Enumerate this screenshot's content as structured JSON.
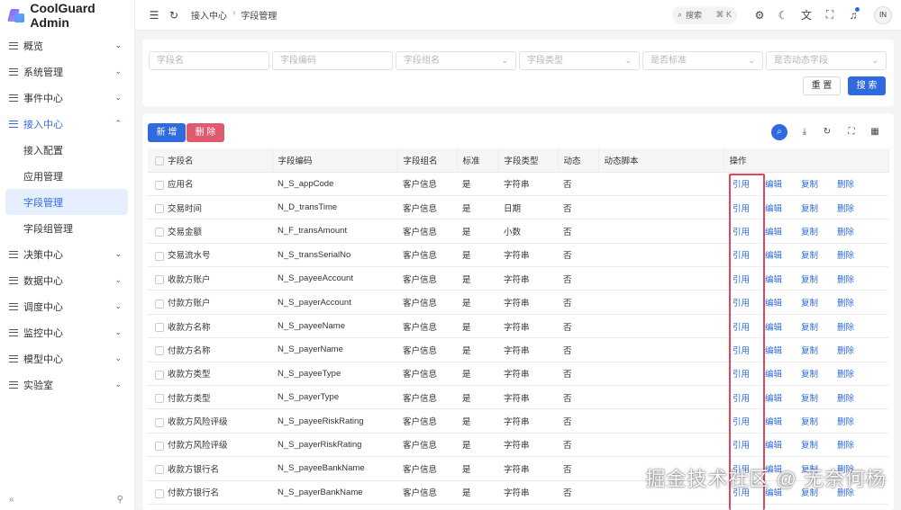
{
  "app": {
    "title": "CoolGuard Admin"
  },
  "sidebar": {
    "items": [
      {
        "label": "概览",
        "open": false
      },
      {
        "label": "系统管理",
        "open": false
      },
      {
        "label": "事件中心",
        "open": false
      },
      {
        "label": "接入中心",
        "open": true,
        "children": [
          {
            "label": "接入配置",
            "active": false
          },
          {
            "label": "应用管理",
            "active": false
          },
          {
            "label": "字段管理",
            "active": true
          },
          {
            "label": "字段组管理",
            "active": false
          }
        ]
      },
      {
        "label": "决策中心",
        "open": false
      },
      {
        "label": "数据中心",
        "open": false
      },
      {
        "label": "调度中心",
        "open": false
      },
      {
        "label": "监控中心",
        "open": false
      },
      {
        "label": "模型中心",
        "open": false
      },
      {
        "label": "实验室",
        "open": false
      }
    ],
    "collapse_icon": "«",
    "pin_icon": "pin-icon"
  },
  "header": {
    "breadcrumb": [
      "接入中心",
      "字段管理"
    ],
    "search_placeholder": "搜索",
    "search_shortcut": "⌘ K",
    "avatar_text": "IN"
  },
  "filters": {
    "field_name_placeholder": "字段名",
    "field_code_placeholder": "字段编码",
    "field_group_placeholder": "字段组名",
    "field_type_placeholder": "字段类型",
    "is_standard_placeholder": "是否标准",
    "is_dynamic_placeholder": "是否动态字段",
    "reset_label": "重 置",
    "search_label": "搜 索"
  },
  "toolbar": {
    "add_label": "新 增",
    "delete_label": "删 除"
  },
  "table": {
    "columns": [
      "字段名",
      "字段编码",
      "字段组名",
      "标准",
      "字段类型",
      "动态",
      "动态脚本",
      "操作"
    ],
    "actions": [
      "引用",
      "编辑",
      "复制",
      "删除"
    ],
    "rows": [
      {
        "name": "应用名",
        "code": "N_S_appCode",
        "group": "客户信息",
        "standard": "是",
        "type": "字符串",
        "dynamic": "否",
        "script": ""
      },
      {
        "name": "交易时间",
        "code": "N_D_transTime",
        "group": "客户信息",
        "standard": "是",
        "type": "日期",
        "dynamic": "否",
        "script": ""
      },
      {
        "name": "交易金额",
        "code": "N_F_transAmount",
        "group": "客户信息",
        "standard": "是",
        "type": "小数",
        "dynamic": "否",
        "script": ""
      },
      {
        "name": "交易流水号",
        "code": "N_S_transSerialNo",
        "group": "客户信息",
        "standard": "是",
        "type": "字符串",
        "dynamic": "否",
        "script": ""
      },
      {
        "name": "收款方账户",
        "code": "N_S_payeeAccount",
        "group": "客户信息",
        "standard": "是",
        "type": "字符串",
        "dynamic": "否",
        "script": ""
      },
      {
        "name": "付款方账户",
        "code": "N_S_payerAccount",
        "group": "客户信息",
        "standard": "是",
        "type": "字符串",
        "dynamic": "否",
        "script": ""
      },
      {
        "name": "收款方名称",
        "code": "N_S_payeeName",
        "group": "客户信息",
        "standard": "是",
        "type": "字符串",
        "dynamic": "否",
        "script": ""
      },
      {
        "name": "付款方名称",
        "code": "N_S_payerName",
        "group": "客户信息",
        "standard": "是",
        "type": "字符串",
        "dynamic": "否",
        "script": ""
      },
      {
        "name": "收款方类型",
        "code": "N_S_payeeType",
        "group": "客户信息",
        "standard": "是",
        "type": "字符串",
        "dynamic": "否",
        "script": ""
      },
      {
        "name": "付款方类型",
        "code": "N_S_payerType",
        "group": "客户信息",
        "standard": "是",
        "type": "字符串",
        "dynamic": "否",
        "script": ""
      },
      {
        "name": "收款方风险评级",
        "code": "N_S_payeeRiskRating",
        "group": "客户信息",
        "standard": "是",
        "type": "字符串",
        "dynamic": "否",
        "script": ""
      },
      {
        "name": "付款方风险评级",
        "code": "N_S_payerRiskRating",
        "group": "客户信息",
        "standard": "是",
        "type": "字符串",
        "dynamic": "否",
        "script": ""
      },
      {
        "name": "收款方银行名",
        "code": "N_S_payeeBankName",
        "group": "客户信息",
        "standard": "是",
        "type": "字符串",
        "dynamic": "否",
        "script": ""
      },
      {
        "name": "付款方银行名",
        "code": "N_S_payerBankName",
        "group": "客户信息",
        "standard": "是",
        "type": "字符串",
        "dynamic": "否",
        "script": ""
      }
    ]
  },
  "watermark": "掘金技术社区 @ 无奈何杨",
  "colors": {
    "accent": "#2f6bdf",
    "danger": "#e05a6e",
    "highlight": "#e0455f"
  }
}
